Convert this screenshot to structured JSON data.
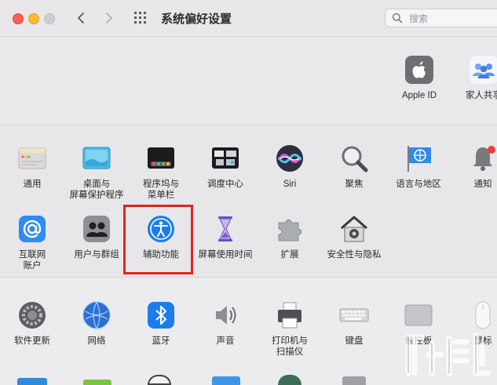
{
  "window": {
    "title": "系统偏好设置"
  },
  "search": {
    "placeholder": "搜索"
  },
  "account": {
    "items": [
      {
        "label": "Apple ID"
      },
      {
        "label": "家人共享"
      }
    ]
  },
  "row1": [
    {
      "label": "通用"
    },
    {
      "label": "桌面与\n屏幕保护程序"
    },
    {
      "label": "程序坞与\n菜单栏"
    },
    {
      "label": "调度中心"
    },
    {
      "label": "Siri"
    },
    {
      "label": "聚焦"
    },
    {
      "label": "语言与地区"
    },
    {
      "label": "通知"
    }
  ],
  "row2": [
    {
      "label": "互联网\n账户"
    },
    {
      "label": "用户与群组"
    },
    {
      "label": "辅助功能"
    },
    {
      "label": "屏幕使用时间"
    },
    {
      "label": "扩展"
    },
    {
      "label": "安全性与隐私"
    }
  ],
  "row3": [
    {
      "label": "软件更新"
    },
    {
      "label": "网络"
    },
    {
      "label": "蓝牙"
    },
    {
      "label": "声音"
    },
    {
      "label": "打印机与\n扫描仪"
    },
    {
      "label": "键盘"
    },
    {
      "label": "触控板"
    },
    {
      "label": "鼠标"
    }
  ],
  "colors": {
    "highlight": "#e0251c",
    "accent": "#1b7cf0"
  }
}
